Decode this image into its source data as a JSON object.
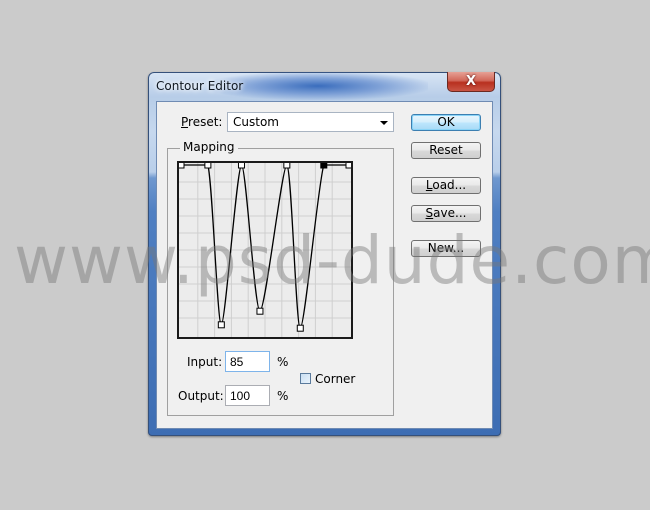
{
  "window": {
    "title": "Contour Editor",
    "close_label": "X"
  },
  "preset": {
    "label_prefix": "",
    "label_mnemonic": "P",
    "label_rest": "reset:",
    "value": "Custom"
  },
  "buttons": {
    "ok": "OK",
    "reset": "Reset",
    "load_mnemonic": "L",
    "load_rest": "oad...",
    "save_mnemonic": "S",
    "save_rest": "ave...",
    "new": "New..."
  },
  "mapping": {
    "legend": "Mapping",
    "grid_divisions": 10,
    "curve_points": [
      {
        "input": 0,
        "output": 100
      },
      {
        "input": 16,
        "output": 100
      },
      {
        "input": 24,
        "output": 6
      },
      {
        "input": 36,
        "output": 100
      },
      {
        "input": 47,
        "output": 14
      },
      {
        "input": 63,
        "output": 100
      },
      {
        "input": 71,
        "output": 4
      },
      {
        "input": 85,
        "output": 100,
        "selected": true
      },
      {
        "input": 100,
        "output": 100
      }
    ]
  },
  "fields": {
    "input_label": "Input:",
    "input_value": "85",
    "input_unit": "%",
    "output_label": "Output:",
    "output_value": "100",
    "output_unit": "%",
    "corner_label": "Corner",
    "corner_checked": false
  },
  "watermark": "www.psd-dude.com"
}
